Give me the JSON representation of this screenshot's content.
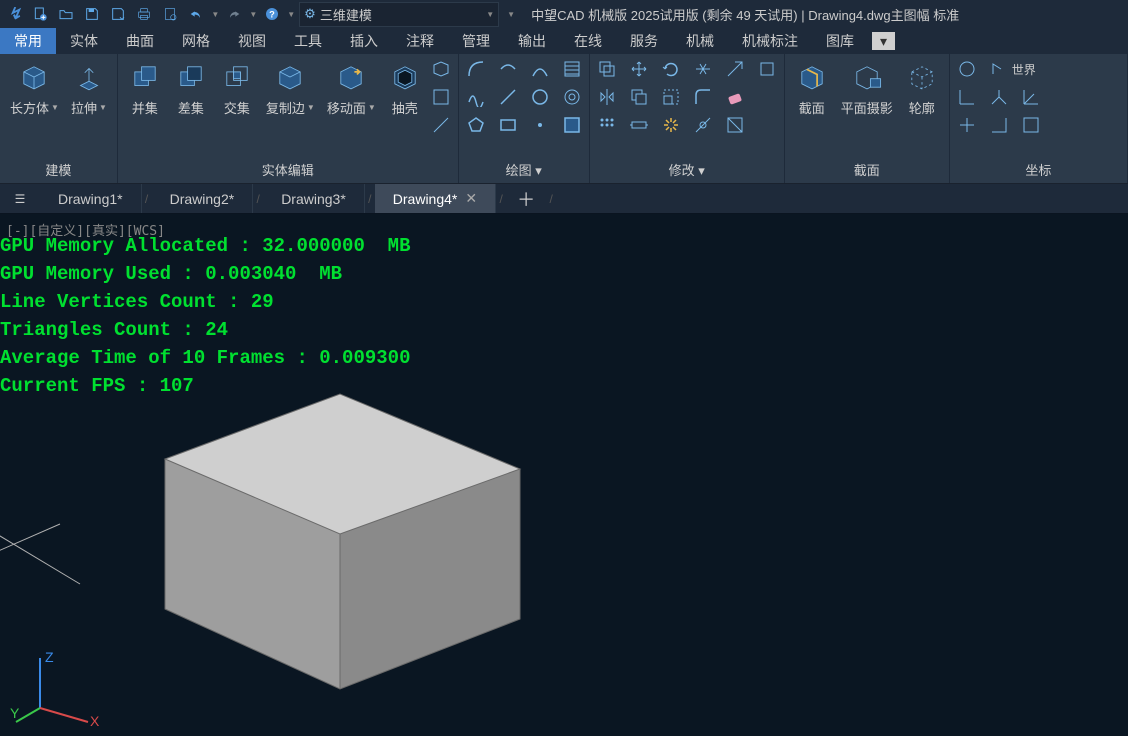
{
  "title": "中望CAD 机械版 2025试用版 (剩余 49 天试用) | Drawing4.dwg主图幅  标准",
  "workspace": "三维建模",
  "menu": [
    "常用",
    "实体",
    "曲面",
    "网格",
    "视图",
    "工具",
    "插入",
    "注释",
    "管理",
    "输出",
    "在线",
    "服务",
    "机械",
    "机械标注",
    "图库"
  ],
  "active_menu": 0,
  "ribbon": {
    "p1": {
      "label": "建模",
      "b1": "长方体",
      "b2": "拉伸"
    },
    "p2": {
      "label": "实体编辑",
      "b1": "并集",
      "b2": "差集",
      "b3": "交集",
      "b4": "复制边",
      "b5": "移动面",
      "b6": "抽壳"
    },
    "p3": {
      "label": "绘图"
    },
    "p4": {
      "label": "修改"
    },
    "p5": {
      "label": "截面",
      "b1": "截面",
      "b2": "平面摄影",
      "b3": "轮廓"
    },
    "p6": {
      "label": "坐标",
      "t1": "世界"
    }
  },
  "tabs": [
    "Drawing1*",
    "Drawing2*",
    "Drawing3*",
    "Drawing4*"
  ],
  "active_tab": 3,
  "viewport_label": "[-][自定义][真实][WCS]",
  "debug": {
    "l1": "GPU Memory Allocated : 32.000000  MB",
    "l2": "GPU Memory Used : 0.003040  MB",
    "l3": "Line Vertices Count : 29",
    "l4": "Triangles Count : 24",
    "l5": "Average Time of 10 Frames : 0.009300",
    "l6": "Current FPS : 107"
  },
  "ucs": {
    "x": "X",
    "y": "Y",
    "z": "Z"
  }
}
